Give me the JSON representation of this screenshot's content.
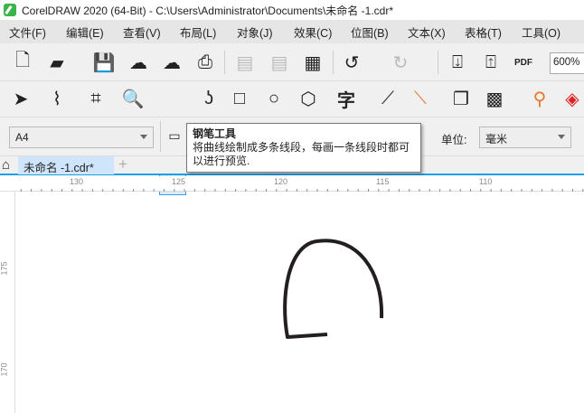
{
  "title": "CorelDRAW 2020 (64-Bit) - C:\\Users\\Administrator\\Documents\\未命名 -1.cdr*",
  "menu": [
    "文件(F)",
    "编辑(E)",
    "查看(V)",
    "布局(L)",
    "对象(J)",
    "效果(C)",
    "位图(B)",
    "文本(X)",
    "表格(T)",
    "工具(O)"
  ],
  "toolbar": {
    "zoom": "600%",
    "pdf": "PDF"
  },
  "property_bar": {
    "page_size": "A4",
    "unit_label": "单位:",
    "unit_value": "毫米"
  },
  "tab": {
    "label": "未命名 -1.cdr*",
    "add": "+"
  },
  "tooltip": {
    "title": "钢笔工具",
    "text": "将曲线绘制成多条线段，每画一条线段时都可以进行预览."
  },
  "ruler": {
    "top": [
      "130",
      "125",
      "120",
      "115",
      "110"
    ],
    "left": [
      "175",
      "170"
    ]
  },
  "colors": {
    "accent": "#1ea0e8",
    "logo": "#3bb54a"
  }
}
